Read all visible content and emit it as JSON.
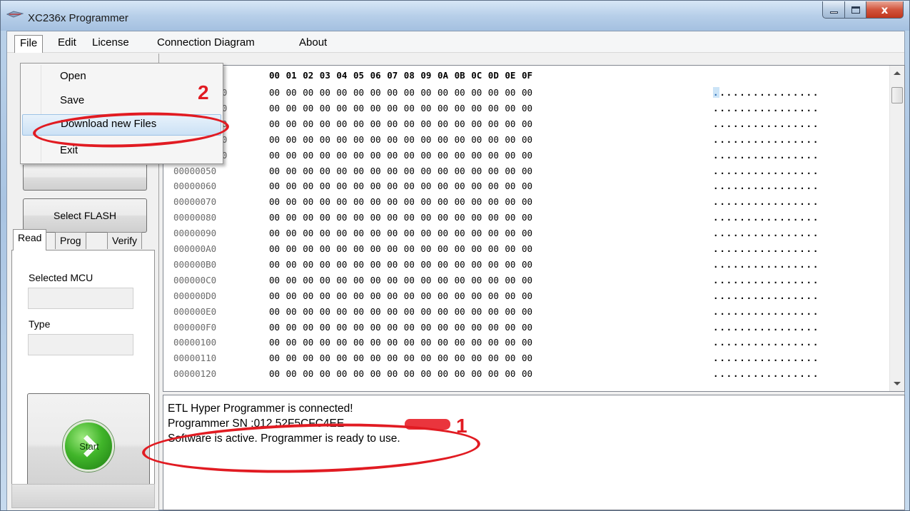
{
  "window": {
    "title": "XC236x Programmer",
    "close_glyph": "x"
  },
  "menubar": {
    "items": [
      "File",
      "Edit",
      "License",
      "Connection Diagram",
      "About"
    ]
  },
  "file_menu": {
    "items": [
      "Open",
      "Save",
      "Download new Files",
      "Exit"
    ],
    "highlighted": "Download new Files"
  },
  "left_panel": {
    "select_flash_label": "Select FLASH",
    "tabs": [
      "Read",
      "Prog",
      "Verify"
    ],
    "active_tab": "Read",
    "selected_mcu_label": "Selected MCU",
    "selected_mcu_value": "",
    "type_label": "Type",
    "type_value": "",
    "start_label": "Start"
  },
  "hex_view": {
    "column_headers": [
      "00",
      "01",
      "02",
      "03",
      "04",
      "05",
      "06",
      "07",
      "08",
      "09",
      "0A",
      "0B",
      "0C",
      "0D",
      "0E",
      "0F"
    ],
    "rows": [
      {
        "address": "00000000",
        "address_visible": "00"
      },
      {
        "address": "00000010",
        "address_visible": "10"
      },
      {
        "address": "00000020",
        "address_visible": "20"
      },
      {
        "address": "00000030",
        "address_visible": "30"
      },
      {
        "address": "00000040",
        "address_visible": "40"
      },
      {
        "address": "00000050",
        "address_visible": "00000050"
      },
      {
        "address": "00000060",
        "address_visible": "00000060"
      },
      {
        "address": "00000070",
        "address_visible": "00000070"
      },
      {
        "address": "00000080",
        "address_visible": "00000080"
      },
      {
        "address": "00000090",
        "address_visible": "00000090"
      },
      {
        "address": "000000A0",
        "address_visible": "000000A0"
      },
      {
        "address": "000000B0",
        "address_visible": "000000B0"
      },
      {
        "address": "000000C0",
        "address_visible": "000000C0"
      },
      {
        "address": "000000D0",
        "address_visible": "000000D0"
      },
      {
        "address": "000000E0",
        "address_visible": "000000E0"
      },
      {
        "address": "000000F0",
        "address_visible": "000000F0"
      },
      {
        "address": "00000100",
        "address_visible": "00000100"
      },
      {
        "address": "00000110",
        "address_visible": "00000110"
      },
      {
        "address": "00000120",
        "address_visible": "00000120"
      }
    ],
    "byte_value": "00",
    "ascii_row": "................",
    "selected_byte": "00"
  },
  "log": {
    "lines": [
      "ETL Hyper Programmer is connected!",
      "Programmer SN :012          52F5CFC4EE",
      "Software is active. Programmer is ready to use."
    ]
  },
  "annotations": {
    "label_1": "1",
    "label_2": "2",
    "color": "#e11b22"
  },
  "colors": {
    "titlebar": "#b7cfe9",
    "close_button": "#c0361c",
    "start_button": "#41b52a",
    "menu_highlight": "#cce1f5"
  }
}
